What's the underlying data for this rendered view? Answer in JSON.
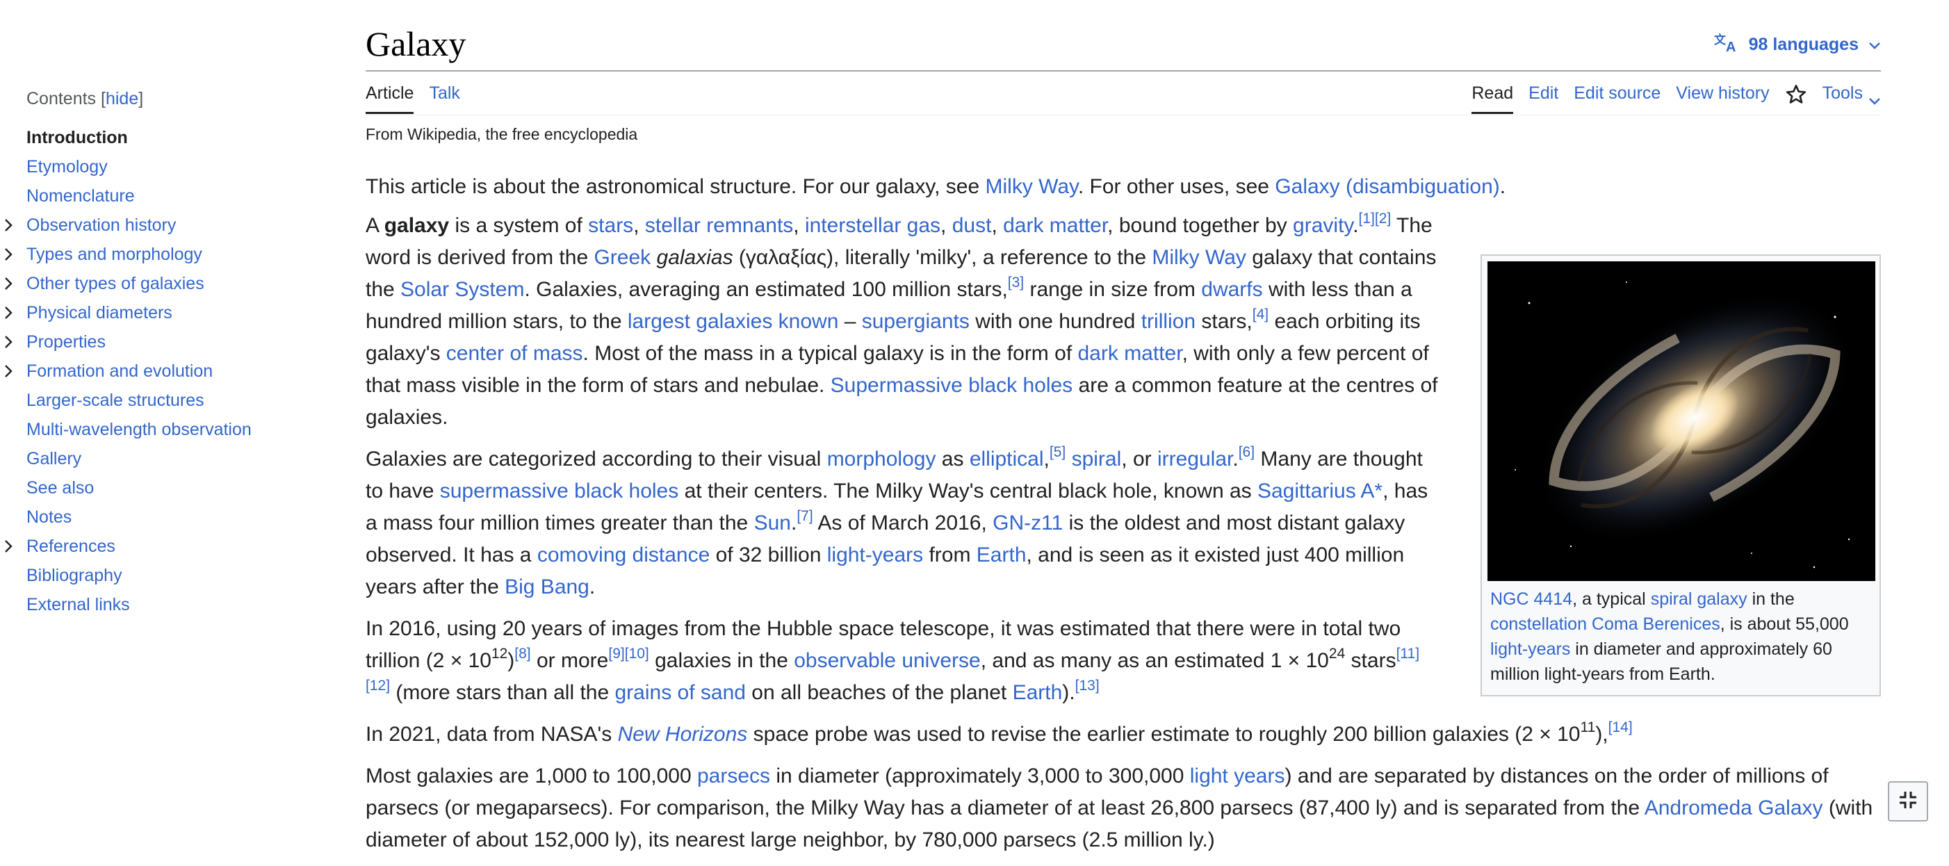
{
  "page": {
    "title": "Galaxy",
    "language_button": "98 languages",
    "tagline": "From Wikipedia, the free encyclopedia"
  },
  "tabs": {
    "article": "Article",
    "talk": "Talk",
    "read": "Read",
    "edit": "Edit",
    "edit_source": "Edit source",
    "view_history": "View history",
    "tools": "Tools"
  },
  "toc": {
    "heading": "Contents",
    "hide": "hide",
    "items": [
      {
        "label": "Introduction",
        "active": true,
        "expandable": false
      },
      {
        "label": "Etymology",
        "expandable": false
      },
      {
        "label": "Nomenclature",
        "expandable": false
      },
      {
        "label": "Observation history",
        "expandable": true
      },
      {
        "label": "Types and morphology",
        "expandable": true
      },
      {
        "label": "Other types of galaxies",
        "expandable": true
      },
      {
        "label": "Physical diameters",
        "expandable": true
      },
      {
        "label": "Properties",
        "expandable": true
      },
      {
        "label": "Formation and evolution",
        "expandable": true
      },
      {
        "label": "Larger-scale structures",
        "expandable": false
      },
      {
        "label": "Multi-wavelength observation",
        "expandable": false
      },
      {
        "label": "Gallery",
        "expandable": false
      },
      {
        "label": "See also",
        "expandable": false
      },
      {
        "label": "Notes",
        "expandable": false
      },
      {
        "label": "References",
        "expandable": true
      },
      {
        "label": "Bibliography",
        "expandable": false
      },
      {
        "label": "External links",
        "expandable": false
      }
    ]
  },
  "hatnote": [
    {
      "t": "This article is about the astronomical structure. For our galaxy, see "
    },
    {
      "link": "Milky Way"
    },
    {
      "t": ". For other uses, see "
    },
    {
      "link": "Galaxy (disambiguation)"
    },
    {
      "t": "."
    }
  ],
  "paragraphs": [
    [
      {
        "t": "A "
      },
      {
        "b": "galaxy"
      },
      {
        "t": " is a system of "
      },
      {
        "link": "stars"
      },
      {
        "t": ", "
      },
      {
        "link": "stellar remnants"
      },
      {
        "t": ", "
      },
      {
        "link": "interstellar gas"
      },
      {
        "t": ", "
      },
      {
        "link": "dust"
      },
      {
        "t": ", "
      },
      {
        "link": "dark matter"
      },
      {
        "t": ", bound together by "
      },
      {
        "link": "gravity"
      },
      {
        "t": "."
      },
      {
        "sup": "[1]"
      },
      {
        "sup": "[2]"
      },
      {
        "t": " The word is derived from the "
      },
      {
        "link": "Greek"
      },
      {
        "t": " "
      },
      {
        "i": "galaxias"
      },
      {
        "t": " (γαλαξίας), literally 'milky', a reference to the "
      },
      {
        "link": "Milky Way"
      },
      {
        "t": " galaxy that contains the "
      },
      {
        "link": "Solar System"
      },
      {
        "t": ". Galaxies, averaging an estimated 100 million stars,"
      },
      {
        "sup": "[3]"
      },
      {
        "t": " range in size from "
      },
      {
        "link": "dwarfs"
      },
      {
        "t": " with less than a hundred million stars, to the "
      },
      {
        "link": "largest galaxies known"
      },
      {
        "t": " – "
      },
      {
        "link": "supergiants"
      },
      {
        "t": " with one hundred "
      },
      {
        "link": "trillion"
      },
      {
        "t": " stars,"
      },
      {
        "sup": "[4]"
      },
      {
        "t": " each orbiting its galaxy's "
      },
      {
        "link": "center of mass"
      },
      {
        "t": ". Most of the mass in a typical galaxy is in the form of "
      },
      {
        "link": "dark matter"
      },
      {
        "t": ", with only a few percent of that mass visible in the form of stars and nebulae. "
      },
      {
        "link": "Supermassive black holes"
      },
      {
        "t": " are a common feature at the centres of galaxies."
      }
    ],
    [
      {
        "t": "Galaxies are categorized according to their visual "
      },
      {
        "link": "morphology"
      },
      {
        "t": " as "
      },
      {
        "link": "elliptical"
      },
      {
        "t": ","
      },
      {
        "sup": "[5]"
      },
      {
        "t": " "
      },
      {
        "link": "spiral"
      },
      {
        "t": ", or "
      },
      {
        "link": "irregular"
      },
      {
        "t": "."
      },
      {
        "sup": "[6]"
      },
      {
        "t": " Many are thought to have "
      },
      {
        "link": "supermassive black holes"
      },
      {
        "t": " at their centers. The Milky Way's central black hole, known as "
      },
      {
        "link": "Sagittarius A*"
      },
      {
        "t": ", has a mass four million times greater than the "
      },
      {
        "link": "Sun"
      },
      {
        "t": "."
      },
      {
        "sup": "[7]"
      },
      {
        "t": " As of March 2016, "
      },
      {
        "link": "GN-z11"
      },
      {
        "t": " is the oldest and most distant galaxy observed. It has a "
      },
      {
        "link": "comoving distance"
      },
      {
        "t": " of 32 billion "
      },
      {
        "link": "light-years"
      },
      {
        "t": " from "
      },
      {
        "link": "Earth"
      },
      {
        "t": ", and is seen as it existed just 400 million years after the "
      },
      {
        "link": "Big Bang"
      },
      {
        "t": "."
      }
    ],
    [
      {
        "t": "In 2016, using 20 years of images from the Hubble space telescope, it was estimated that there were in total two trillion (2 × 10"
      },
      {
        "sup": "12"
      },
      {
        "t": ")"
      },
      {
        "sup": "[8]"
      },
      {
        "t": " or more"
      },
      {
        "sup": "[9]"
      },
      {
        "sup": "[10]"
      },
      {
        "t": " galaxies in the "
      },
      {
        "link": "observable universe"
      },
      {
        "t": ", and as many as an estimated 1 × 10"
      },
      {
        "sup": "24"
      },
      {
        "t": " stars"
      },
      {
        "sup": "[11]"
      },
      {
        "sup": "[12]"
      },
      {
        "t": " (more stars than all the "
      },
      {
        "link": "grains of sand"
      },
      {
        "t": " on all beaches of the planet "
      },
      {
        "link": "Earth"
      },
      {
        "t": ")."
      },
      {
        "sup": "[13]"
      }
    ],
    [
      {
        "t": "In 2021, data from NASA's "
      },
      {
        "ilink": "New Horizons"
      },
      {
        "t": " space probe was used to revise the earlier estimate to roughly 200 billion galaxies (2 × 10"
      },
      {
        "sup": "11"
      },
      {
        "t": "),"
      },
      {
        "sup": "[14]"
      }
    ],
    [
      {
        "t": "Most galaxies are 1,000 to 100,000 "
      },
      {
        "link": "parsecs"
      },
      {
        "t": " in diameter (approximately 3,000 to 300,000 "
      },
      {
        "link": "light years"
      },
      {
        "t": ") and are separated by distances on the order of millions of parsecs (or megaparsecs). For comparison, the Milky Way has a diameter of at least 26,800 parsecs (87,400 ly) and is separated from the "
      },
      {
        "link": "Andromeda Galaxy"
      },
      {
        "t": " (with diameter of about 152,000 ly), its nearest large neighbor, by 780,000 parsecs (2.5 million ly.)"
      }
    ]
  ],
  "figure": {
    "image_name": "ngc-4414-spiral-galaxy-photo",
    "caption": [
      {
        "link": "NGC 4414"
      },
      {
        "t": ", a typical "
      },
      {
        "link": "spiral galaxy"
      },
      {
        "t": " in the "
      },
      {
        "link": "constellation Coma Berenices"
      },
      {
        "t": ", is about 55,000 "
      },
      {
        "link": "light-years"
      },
      {
        "t": " in diameter and approximately 60 million light-years from Earth."
      }
    ]
  },
  "colors": {
    "link": "#3366cc",
    "text": "#202122",
    "border": "#a2a9b1"
  }
}
